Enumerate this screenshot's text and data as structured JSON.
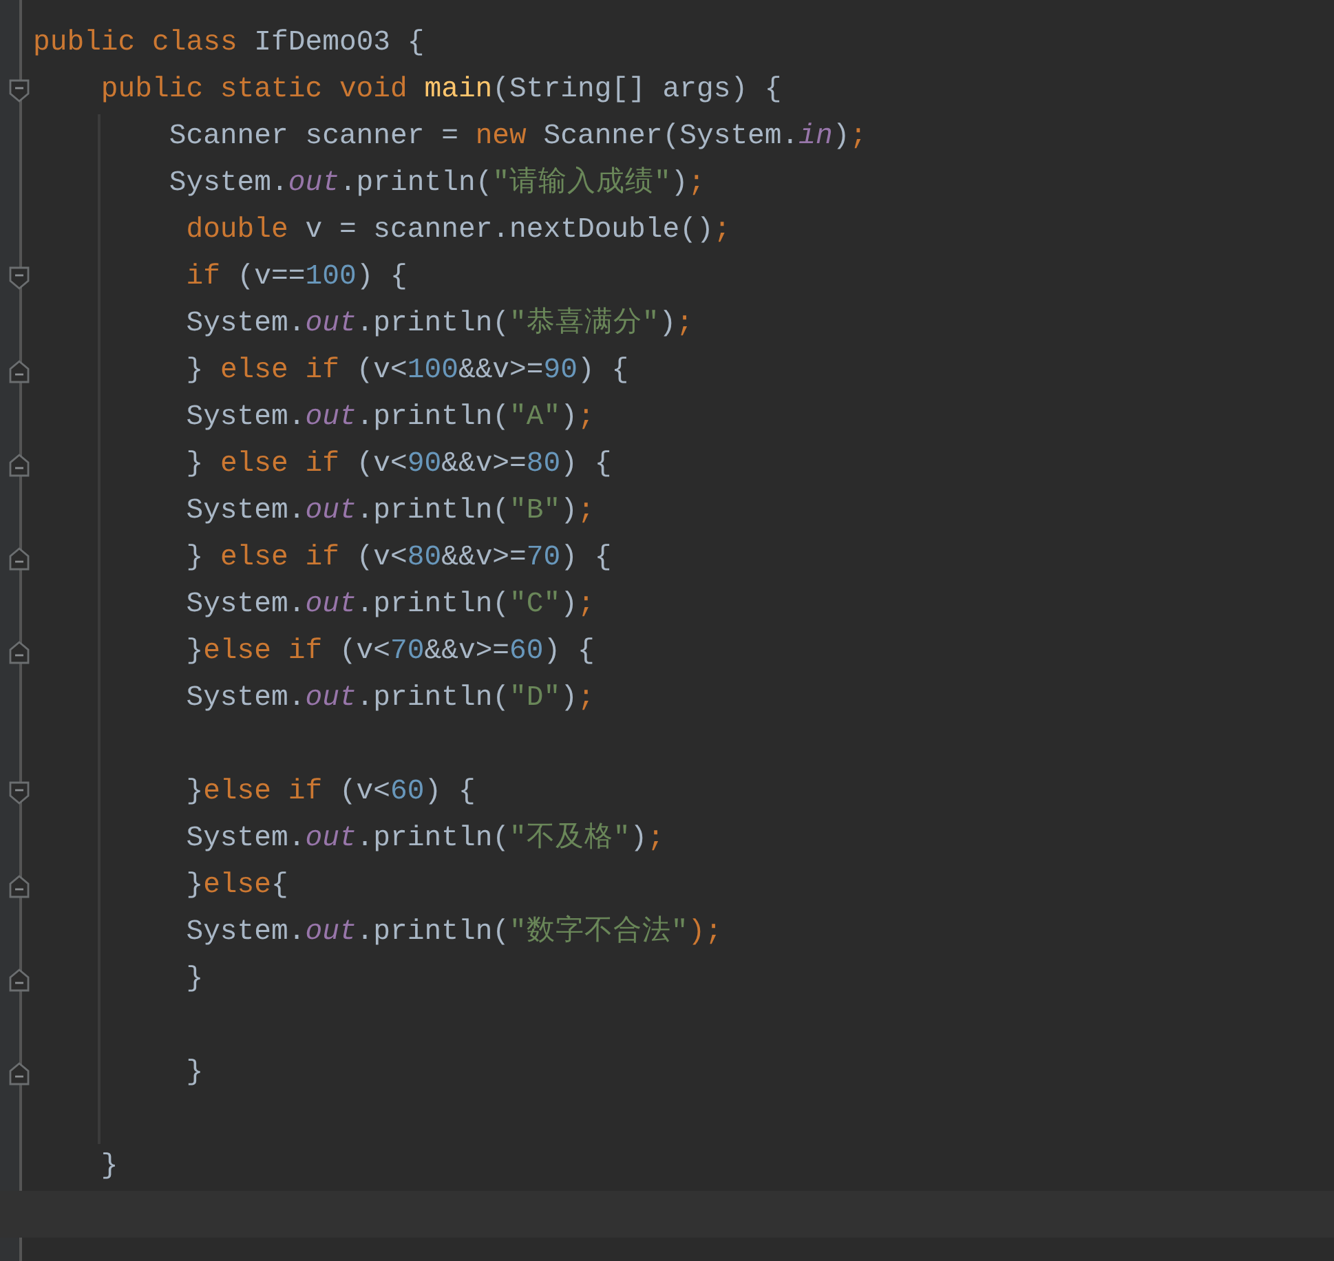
{
  "editor": {
    "lines": [
      {
        "tokens": [
          {
            "kind": "keyword",
            "text": "public class "
          },
          {
            "kind": "plain",
            "text": "IfDemo03 {"
          }
        ]
      },
      {
        "fold_start": true,
        "tokens": [
          {
            "kind": "keyword",
            "text": "    public static void "
          },
          {
            "kind": "method",
            "text": "main"
          },
          {
            "kind": "plain",
            "text": "(String[] args) {"
          }
        ]
      },
      {
        "tokens": [
          {
            "kind": "plain",
            "text": "        Scanner scanner = "
          },
          {
            "kind": "keyword",
            "text": "new "
          },
          {
            "kind": "plain",
            "text": "Scanner(System."
          },
          {
            "kind": "field",
            "text": "in"
          },
          {
            "kind": "plain",
            "text": ")"
          },
          {
            "kind": "keyword",
            "text": ";"
          }
        ]
      },
      {
        "tokens": [
          {
            "kind": "plain",
            "text": "        System."
          },
          {
            "kind": "field",
            "text": "out"
          },
          {
            "kind": "plain",
            "text": ".println("
          },
          {
            "kind": "string",
            "text": "\"请输入成绩\""
          },
          {
            "kind": "plain",
            "text": ")"
          },
          {
            "kind": "keyword",
            "text": ";"
          }
        ]
      },
      {
        "tokens": [
          {
            "kind": "keyword",
            "text": "         double "
          },
          {
            "kind": "plain",
            "text": "v = scanner.nextDouble()"
          },
          {
            "kind": "keyword",
            "text": ";"
          }
        ]
      },
      {
        "fold_start": true,
        "tokens": [
          {
            "kind": "keyword",
            "text": "         if "
          },
          {
            "kind": "plain",
            "text": "(v=="
          },
          {
            "kind": "number",
            "text": "100"
          },
          {
            "kind": "plain",
            "text": ") {"
          }
        ]
      },
      {
        "tokens": [
          {
            "kind": "plain",
            "text": "         System."
          },
          {
            "kind": "field",
            "text": "out"
          },
          {
            "kind": "plain",
            "text": ".println("
          },
          {
            "kind": "string",
            "text": "\"恭喜满分\""
          },
          {
            "kind": "plain",
            "text": ")"
          },
          {
            "kind": "keyword",
            "text": ";"
          }
        ]
      },
      {
        "fold_end": true,
        "tokens": [
          {
            "kind": "plain",
            "text": "         } "
          },
          {
            "kind": "keyword",
            "text": "else if "
          },
          {
            "kind": "plain",
            "text": "(v<"
          },
          {
            "kind": "number",
            "text": "100"
          },
          {
            "kind": "plain",
            "text": "&&v>="
          },
          {
            "kind": "number",
            "text": "90"
          },
          {
            "kind": "plain",
            "text": ") {"
          }
        ]
      },
      {
        "tokens": [
          {
            "kind": "plain",
            "text": "         System."
          },
          {
            "kind": "field",
            "text": "out"
          },
          {
            "kind": "plain",
            "text": ".println("
          },
          {
            "kind": "string",
            "text": "\"A\""
          },
          {
            "kind": "plain",
            "text": ")"
          },
          {
            "kind": "keyword",
            "text": ";"
          }
        ]
      },
      {
        "fold_end": true,
        "tokens": [
          {
            "kind": "plain",
            "text": "         } "
          },
          {
            "kind": "keyword",
            "text": "else if "
          },
          {
            "kind": "plain",
            "text": "(v<"
          },
          {
            "kind": "number",
            "text": "90"
          },
          {
            "kind": "plain",
            "text": "&&v>="
          },
          {
            "kind": "number",
            "text": "80"
          },
          {
            "kind": "plain",
            "text": ") {"
          }
        ]
      },
      {
        "tokens": [
          {
            "kind": "plain",
            "text": "         System."
          },
          {
            "kind": "field",
            "text": "out"
          },
          {
            "kind": "plain",
            "text": ".println("
          },
          {
            "kind": "string",
            "text": "\"B\""
          },
          {
            "kind": "plain",
            "text": ")"
          },
          {
            "kind": "keyword",
            "text": ";"
          }
        ]
      },
      {
        "fold_end": true,
        "tokens": [
          {
            "kind": "plain",
            "text": "         } "
          },
          {
            "kind": "keyword",
            "text": "else if "
          },
          {
            "kind": "plain",
            "text": "(v<"
          },
          {
            "kind": "number",
            "text": "80"
          },
          {
            "kind": "plain",
            "text": "&&v>="
          },
          {
            "kind": "number",
            "text": "70"
          },
          {
            "kind": "plain",
            "text": ") {"
          }
        ]
      },
      {
        "tokens": [
          {
            "kind": "plain",
            "text": "         System."
          },
          {
            "kind": "field",
            "text": "out"
          },
          {
            "kind": "plain",
            "text": ".println("
          },
          {
            "kind": "string",
            "text": "\"C\""
          },
          {
            "kind": "plain",
            "text": ")"
          },
          {
            "kind": "keyword",
            "text": ";"
          }
        ]
      },
      {
        "fold_end": true,
        "tokens": [
          {
            "kind": "plain",
            "text": "         }"
          },
          {
            "kind": "keyword",
            "text": "else if "
          },
          {
            "kind": "plain",
            "text": "(v<"
          },
          {
            "kind": "number",
            "text": "70"
          },
          {
            "kind": "plain",
            "text": "&&v>="
          },
          {
            "kind": "number",
            "text": "60"
          },
          {
            "kind": "plain",
            "text": ") {"
          }
        ]
      },
      {
        "tokens": [
          {
            "kind": "plain",
            "text": "         System."
          },
          {
            "kind": "field",
            "text": "out"
          },
          {
            "kind": "plain",
            "text": ".println("
          },
          {
            "kind": "string",
            "text": "\"D\""
          },
          {
            "kind": "plain",
            "text": ")"
          },
          {
            "kind": "keyword",
            "text": ";"
          }
        ]
      },
      {
        "gap_before": true,
        "fold_start": true,
        "tokens": [
          {
            "kind": "plain",
            "text": "         }"
          },
          {
            "kind": "keyword",
            "text": "else if "
          },
          {
            "kind": "plain",
            "text": "(v<"
          },
          {
            "kind": "number",
            "text": "60"
          },
          {
            "kind": "plain",
            "text": ") {"
          }
        ]
      },
      {
        "tokens": [
          {
            "kind": "plain",
            "text": "         System."
          },
          {
            "kind": "field",
            "text": "out"
          },
          {
            "kind": "plain",
            "text": ".println("
          },
          {
            "kind": "string",
            "text": "\"不及格\""
          },
          {
            "kind": "plain",
            "text": ")"
          },
          {
            "kind": "keyword",
            "text": ";"
          }
        ]
      },
      {
        "fold_end": true,
        "tokens": [
          {
            "kind": "plain",
            "text": "         }"
          },
          {
            "kind": "keyword",
            "text": "else"
          },
          {
            "kind": "plain",
            "text": "{"
          }
        ]
      },
      {
        "tokens": [
          {
            "kind": "plain",
            "text": "         System."
          },
          {
            "kind": "field",
            "text": "out"
          },
          {
            "kind": "plain",
            "text": ".println("
          },
          {
            "kind": "string",
            "text": "\"数字不合法\""
          },
          {
            "kind": "keyword",
            "text": ");"
          }
        ]
      },
      {
        "fold_end": true,
        "tokens": [
          {
            "kind": "plain",
            "text": "         }"
          }
        ]
      },
      {
        "gap_before": true,
        "fold_end": true,
        "tokens": [
          {
            "kind": "plain",
            "text": "         }"
          }
        ]
      },
      {
        "gap_before": true,
        "tokens": [
          {
            "kind": "plain",
            "text": "    }"
          }
        ]
      },
      {
        "current": true
      }
    ]
  }
}
